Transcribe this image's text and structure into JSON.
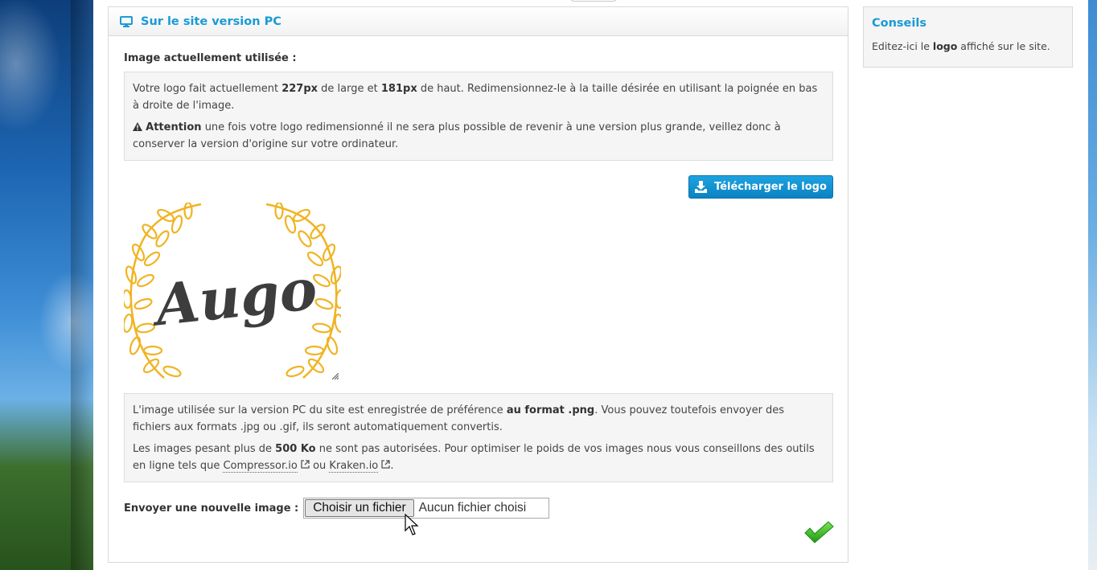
{
  "panel": {
    "title": "Sur le site version PC",
    "icon": "monitor-icon"
  },
  "current_image": {
    "label": "Image actuellement utilisée :"
  },
  "info1": {
    "p1_pre": "Votre logo fait actuellement ",
    "width_value": "227px",
    "p1_mid": " de large et ",
    "height_value": "181px",
    "p1_post": " de haut. Redimensionnez-le à la taille désirée en utilisant la poignée en bas à droite de l'image.",
    "warning_strong": "Attention",
    "warning_text": " une fois votre logo redimensionné il ne sera plus possible de revenir à une version plus grande, veillez donc à conserver la version d'origine sur votre ordinateur."
  },
  "download_button": {
    "label": "Télécharger le logo",
    "icon": "download-icon"
  },
  "logo": {
    "text": "Augo",
    "laurel_color": "#f0b422",
    "text_color": "#3d3d3d"
  },
  "info2": {
    "p1_pre": "L'image utilisée sur la version PC du site est enregistrée de préférence ",
    "p1_strong": "au format .png",
    "p1_post": ". Vous pouvez toutefois envoyer des fichiers aux formats .jpg ou .gif, ils seront automatiquement convertis.",
    "p2_pre": "Les images pesant plus de ",
    "p2_strong": "500 Ko",
    "p2_mid": " ne sont pas autorisées. Pour optimiser le poids de vos images nous vous conseillons des outils en ligne tels que ",
    "link1": "Compressor.io",
    "p2_or": " ou ",
    "link2": "Kraken.io",
    "p2_end": "."
  },
  "upload": {
    "label": "Envoyer une nouvelle image :",
    "choose_button": "Choisir un fichier",
    "status": "Aucun fichier choisi"
  },
  "side": {
    "title": "Conseils",
    "text_pre": "Editez-ici le ",
    "text_strong": "logo",
    "text_post": " affiché sur le site."
  },
  "colors": {
    "accent": "#1a9ad6",
    "button": "#0b82c2",
    "check": "#3cbf1c"
  }
}
